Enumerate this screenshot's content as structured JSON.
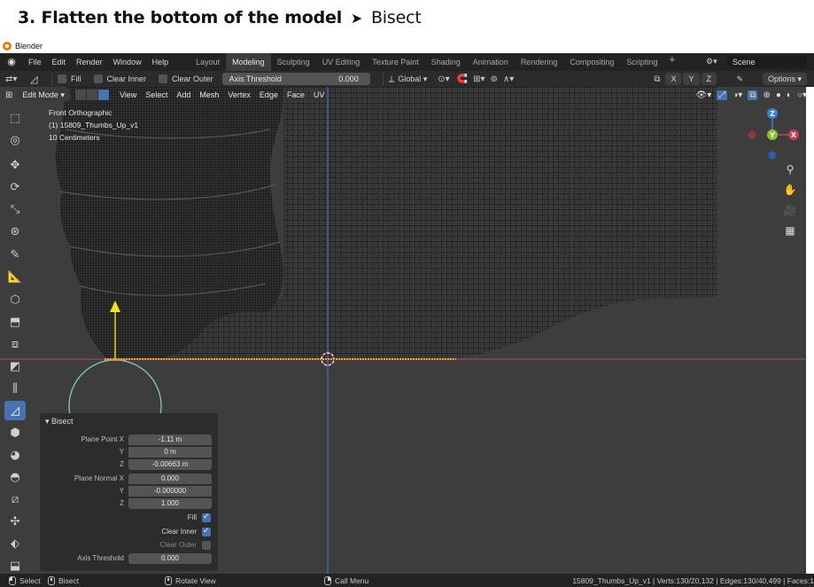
{
  "heading": {
    "bold": "3. Flatten the bottom of the model",
    "arrow": "➤",
    "step": "Bisect"
  },
  "window_title": "Blender",
  "menubar": {
    "menus": [
      "File",
      "Edit",
      "Render",
      "Window",
      "Help"
    ],
    "workspaces": [
      "Layout",
      "Modeling",
      "Sculpting",
      "UV Editing",
      "Texture Paint",
      "Shading",
      "Animation",
      "Rendering",
      "Compositing",
      "Scripting"
    ],
    "active_workspace": "Modeling",
    "add_tab": "+",
    "scene": "Scene"
  },
  "tool_header": {
    "fill_label": "Fill",
    "clear_inner_label": "Clear Inner",
    "clear_outer_label": "Clear Outer",
    "axis_threshold_label": "Axis Threshold",
    "axis_threshold_value": "0.000",
    "orientation": "Global",
    "axes": [
      "X",
      "Y",
      "Z"
    ],
    "options_label": "Options"
  },
  "viewport_header": {
    "mode": "Edit Mode",
    "menus": [
      "View",
      "Select",
      "Add",
      "Mesh",
      "Vertex",
      "Edge",
      "Face",
      "UV"
    ]
  },
  "viewport_info": {
    "view": "Front Orthographic",
    "object": "(1) 15809_Thumbs_Up_v1",
    "scale": "10 Centimeters"
  },
  "gizmo": {
    "z": "Z",
    "y": "Y",
    "x": "X"
  },
  "operator_panel": {
    "title": "Bisect",
    "plane_point_label": "Plane Point X",
    "plane_point": {
      "x": "-1.11 m",
      "y": "0 m",
      "z": "-0.00663 m"
    },
    "plane_normal_label": "Plane Normal X",
    "plane_normal": {
      "x": "0.000",
      "y": "-0.000000",
      "z": "1.000"
    },
    "y_label": "Y",
    "z_label": "Z",
    "fill_label": "Fill",
    "fill": true,
    "clear_inner_label": "Clear Inner",
    "clear_inner": true,
    "clear_outer_label": "Clear Outer",
    "clear_outer": false,
    "axis_threshold_label": "Axis Threshold",
    "axis_threshold": "0.000"
  },
  "statusbar": {
    "select": "Select",
    "bisect": "Bisect",
    "rotate": "Rotate View",
    "call_menu": "Call Menu",
    "stats": "15809_Thumbs_Up_v1 | Verts:130/20,132 | Edges:130/40,499 | Faces:1"
  },
  "colors": {
    "accent": "#4772b3",
    "viewport_bg": "#3d3d3d",
    "axis_x": "#c4414f",
    "axis_y": "#8ac42c",
    "axis_z": "#3a7fdc",
    "gizmo_circle": "#7fd6d0",
    "selected_edge": "#f0a030"
  }
}
